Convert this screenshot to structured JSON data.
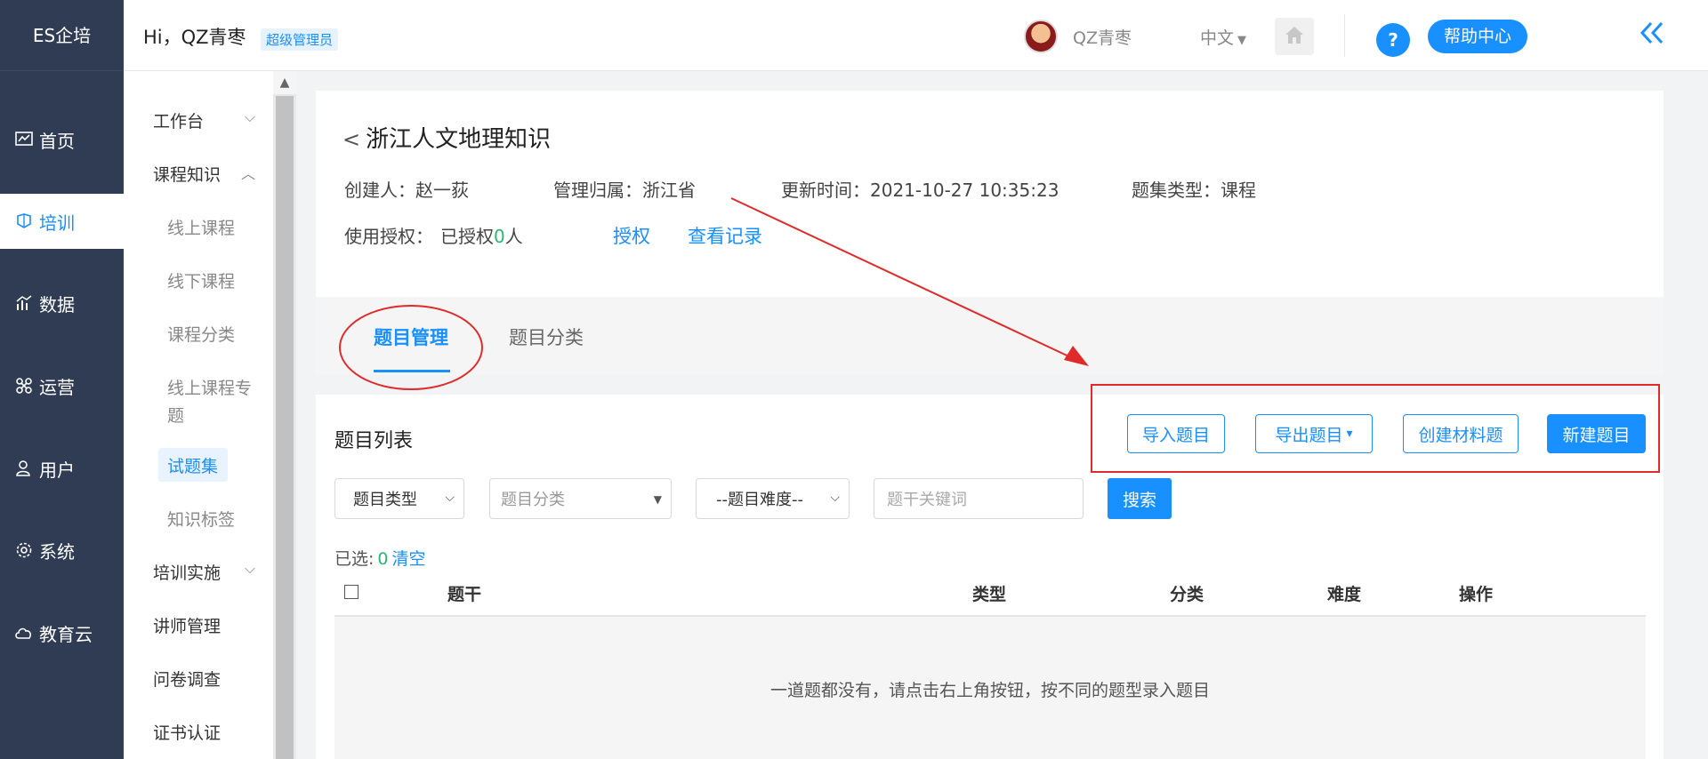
{
  "brand": "ES企培",
  "topbar": {
    "greeting": "Hi，QZ青枣",
    "role": "超级管理员",
    "user": "QZ青枣",
    "language": "中文",
    "help": "帮助中心",
    "help_icon_text": "?"
  },
  "leftnav": [
    {
      "label": "首页",
      "icon": "dashboard-icon"
    },
    {
      "label": "培训",
      "icon": "training-icon",
      "active": true
    },
    {
      "label": "数据",
      "icon": "chart-icon"
    },
    {
      "label": "运营",
      "icon": "operation-icon"
    },
    {
      "label": "用户",
      "icon": "user-icon"
    },
    {
      "label": "系统",
      "icon": "gear-icon"
    },
    {
      "label": "教育云",
      "icon": "cloud-icon"
    }
  ],
  "subnav": {
    "workbench": "工作台",
    "course_knowledge": "课程知识",
    "online_course": "线上课程",
    "offline_course": "线下课程",
    "course_category": "课程分类",
    "online_topic_1": "线上课程专",
    "online_topic_2": "题",
    "question_set": "试题集",
    "knowledge_tag": "知识标签",
    "training_impl": "培训实施",
    "lecturer": "讲师管理",
    "survey": "问卷调查",
    "certificate": "证书认证"
  },
  "detail": {
    "title": "浙江人文地理知识",
    "creator_label": "创建人：",
    "creator": "赵一荻",
    "owner_label": "管理归属：",
    "owner": "浙江省",
    "updated_label": "更新时间：",
    "updated": "2021-10-27 10:35:23",
    "type_label": "题集类型：",
    "type": "课程",
    "auth_label": "使用授权：",
    "auth_prefix": "已授权",
    "auth_count": "0",
    "auth_suffix": "人",
    "authorize_link": "授权",
    "records_link": "查看记录"
  },
  "tabs": {
    "manage": "题目管理",
    "category": "题目分类"
  },
  "list": {
    "title": "题目列表",
    "import_btn": "导入题目",
    "export_btn": "导出题目",
    "export_caret": "▾",
    "material_btn": "创建材料题",
    "new_btn": "新建题目",
    "filter_type": "题目类型",
    "filter_category": "题目分类",
    "filter_difficulty": "--题目难度--",
    "keyword_placeholder": "题干关键词",
    "search_btn": "搜索",
    "selected_label": "已选:",
    "selected_count": "0",
    "clear": "清空",
    "columns": {
      "stem": "题干",
      "type": "类型",
      "category": "分类",
      "difficulty": "难度",
      "action": "操作"
    },
    "empty_text": "一道题都没有，请点击右上角按钮，按不同的题型录入题目"
  },
  "colors": {
    "accent": "#1890ff",
    "nav_bg": "#2f3c53",
    "annotation": "#e02b2b"
  }
}
